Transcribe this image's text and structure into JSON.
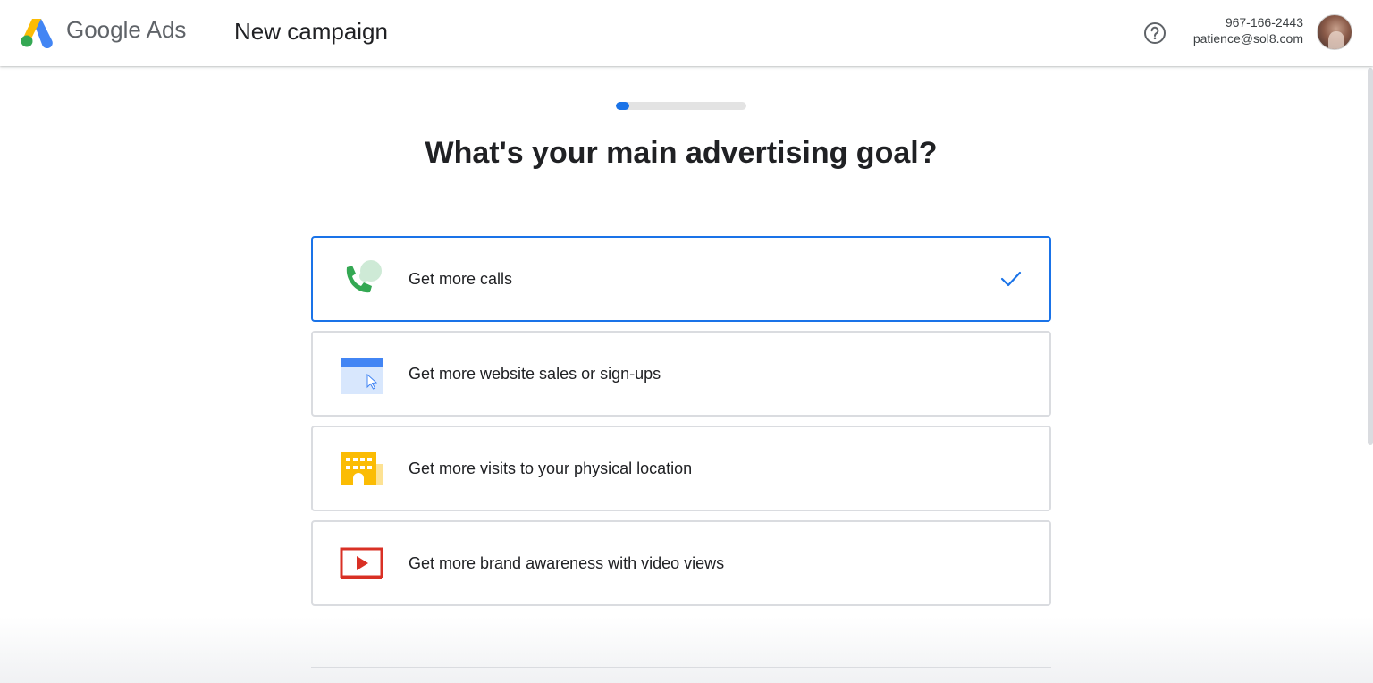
{
  "header": {
    "logo_text": "Google Ads",
    "page_title": "New campaign",
    "help_icon": "help-circle-icon",
    "account_phone": "967-166-2443",
    "account_email": "patience@sol8.com"
  },
  "progress": {
    "step_fraction": 0.1
  },
  "main": {
    "question": "What's your main advertising goal?",
    "goals": [
      {
        "label": "Get more calls",
        "icon": "phone-call-icon",
        "selected": true
      },
      {
        "label": "Get more website sales or sign-ups",
        "icon": "website-cursor-icon",
        "selected": false
      },
      {
        "label": "Get more visits to your physical location",
        "icon": "storefront-icon",
        "selected": false
      },
      {
        "label": "Get more brand awareness with video views",
        "icon": "video-play-icon",
        "selected": false
      }
    ]
  },
  "colors": {
    "accent": "#1a73e8",
    "google_green": "#34a853",
    "google_yellow": "#fbbc04",
    "youtube_red": "#d93025"
  }
}
